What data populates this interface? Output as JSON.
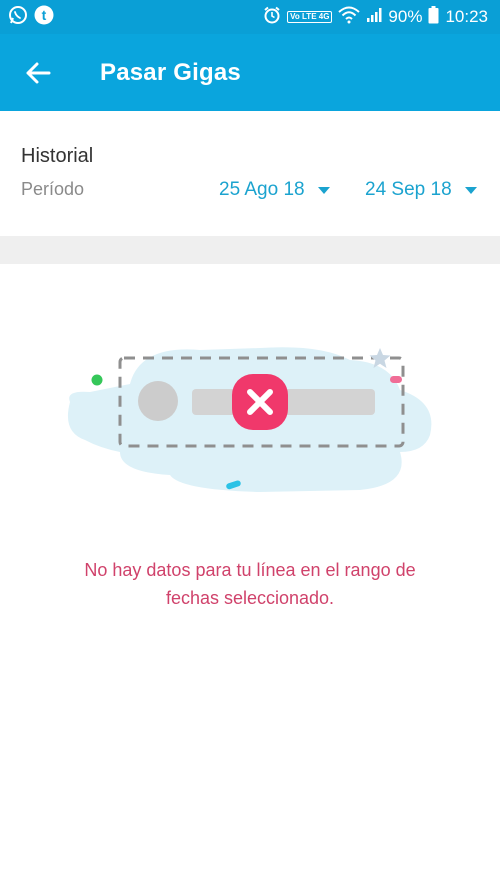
{
  "status_bar": {
    "battery_text": "90%",
    "time": "10:23",
    "network_badge": "Vo LTE 4G",
    "icons": [
      "whatsapp-icon",
      "tumblr-icon",
      "alarm-icon",
      "volte-icon",
      "wifi-icon",
      "signal-icon",
      "battery-icon"
    ]
  },
  "app_bar": {
    "title": "Pasar Gigas",
    "back_icon": "arrow-left-icon"
  },
  "history": {
    "title": "Historial",
    "period_label": "Período",
    "date_from": "25 Ago 18",
    "date_to": "24 Sep 18"
  },
  "empty_state": {
    "message_line1": "No hay datos para tu línea en el rango de",
    "message_line2": "fechas seleccionado.",
    "icon": "error-x-icon"
  },
  "colors": {
    "primary": "#0aa5dd",
    "accent_text": "#1ba3cf",
    "error": "#f0386b",
    "message": "#d0426b"
  }
}
